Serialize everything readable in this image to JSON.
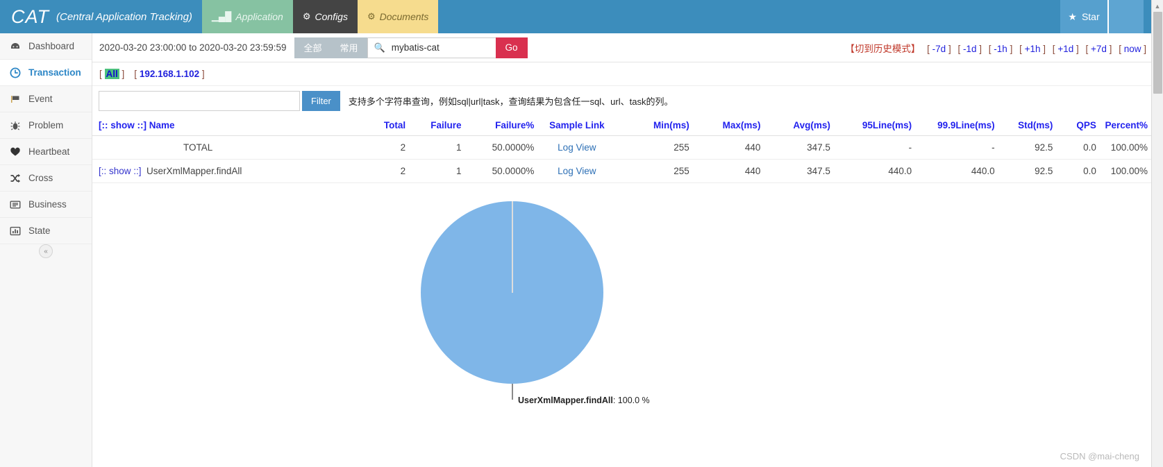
{
  "header": {
    "brand_short": "CAT",
    "brand_full": "(Central Application Tracking)",
    "nav": [
      {
        "label": "Application",
        "icon": "bar-chart-icon"
      },
      {
        "label": "Configs",
        "icon": "gears-icon"
      },
      {
        "label": "Documents",
        "icon": "gears-icon"
      }
    ],
    "star_label": "Star",
    "accent": "#3C8DBC"
  },
  "sidebar": {
    "items": [
      {
        "label": "Dashboard",
        "icon": "dashboard-icon",
        "active": false
      },
      {
        "label": "Transaction",
        "icon": "clock-icon",
        "active": true
      },
      {
        "label": "Event",
        "icon": "flag-icon",
        "active": false
      },
      {
        "label": "Problem",
        "icon": "bug-icon",
        "active": false
      },
      {
        "label": "Heartbeat",
        "icon": "heart-icon",
        "active": false
      },
      {
        "label": "Cross",
        "icon": "shuffle-icon",
        "active": false
      },
      {
        "label": "Business",
        "icon": "list-icon",
        "active": false
      },
      {
        "label": "State",
        "icon": "bar-chart-icon",
        "active": false
      }
    ],
    "collapse_glyph": "«"
  },
  "query": {
    "date_range": "2020-03-20 23:00:00 to 2020-03-20 23:59:59",
    "toggle_all": "全部",
    "toggle_common": "常用",
    "search_value": "mybatis-cat",
    "search_placeholder": "",
    "go_label": "Go",
    "history_mode": "【切到历史模式】",
    "time_links": [
      "-7d",
      "-1d",
      "-1h",
      "+1h",
      "+1d",
      "+7d",
      "now"
    ]
  },
  "ip_row": {
    "all_label": "All",
    "ip_label": "192.168.1.102"
  },
  "filter": {
    "value": "",
    "placeholder": "",
    "button_label": "Filter",
    "hint": "支持多个字符串查询，例如sql|url|task，查询结果为包含任一sql、url、task的列。"
  },
  "table": {
    "columns": [
      "[:: show ::] Name",
      "Total",
      "Failure",
      "Failure%",
      "Sample Link",
      "Min(ms)",
      "Max(ms)",
      "Avg(ms)",
      "95Line(ms)",
      "99.9Line(ms)",
      "Std(ms)",
      "QPS",
      "Percent%"
    ],
    "show_token": "[:: show ::]",
    "sample_link_label": "Log View",
    "rows": [
      {
        "show": "",
        "name": "TOTAL",
        "total": "2",
        "failure": "1",
        "failure_pct": "50.0000%",
        "sample": "Log View",
        "min": "255",
        "max": "440",
        "avg": "347.5",
        "line95": "-",
        "line999": "-",
        "std": "92.5",
        "qps": "0.0",
        "percent": "100.00%"
      },
      {
        "show": "[:: show ::]",
        "name": "UserXmlMapper.findAll",
        "total": "2",
        "failure": "1",
        "failure_pct": "50.0000%",
        "sample": "Log View",
        "min": "255",
        "max": "440",
        "avg": "347.5",
        "line95": "440.0",
        "line999": "440.0",
        "std": "92.5",
        "qps": "0.0",
        "percent": "100.00%"
      }
    ]
  },
  "chart_data": {
    "type": "pie",
    "title": "",
    "labels": [
      "UserXmlMapper.findAll"
    ],
    "values": [
      100.0
    ],
    "unit": "%",
    "colors": [
      "#7FB6E8"
    ],
    "annotations": [
      "UserXmlMapper.findAll: 100.0 %"
    ],
    "label_name": "UserXmlMapper.findAll",
    "label_value": ": 100.0 %",
    "legend": "none"
  },
  "watermark": "CSDN @mai-cheng"
}
